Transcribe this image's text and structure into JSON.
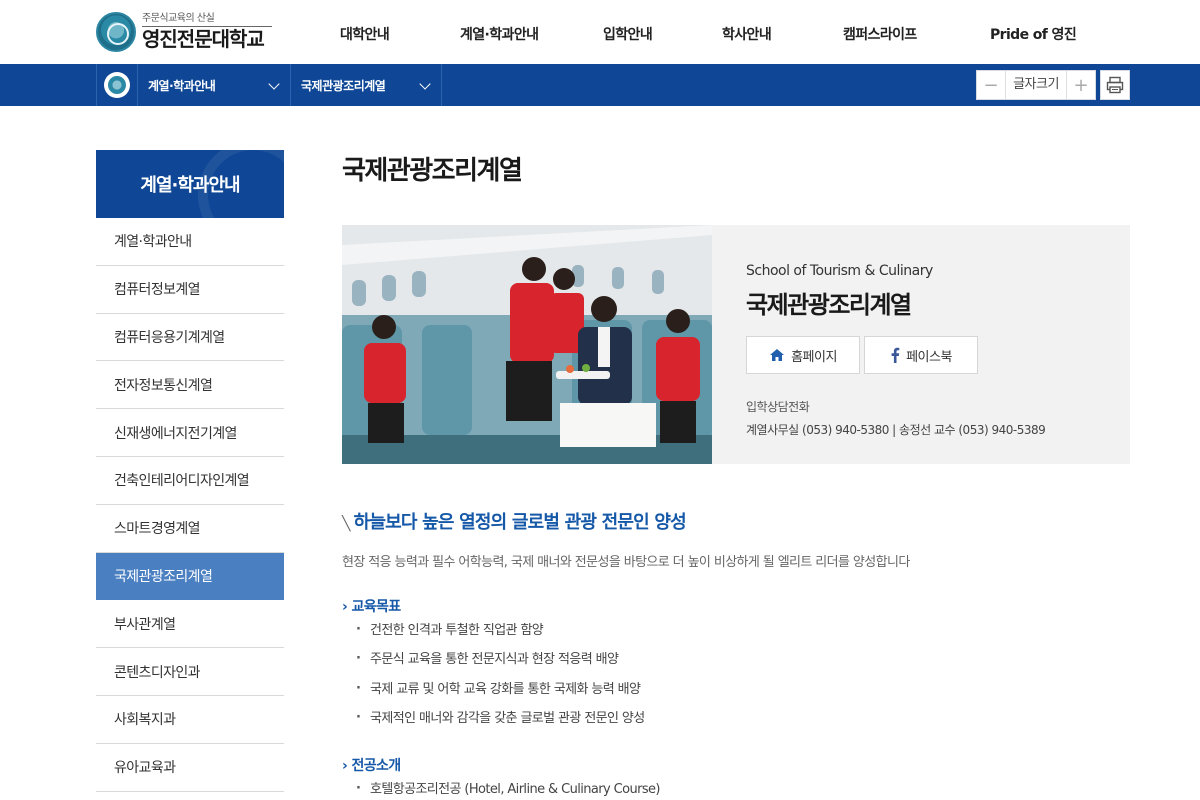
{
  "header": {
    "logo_sub": "주문식교육의 산실",
    "logo_main": "영진전문대학교",
    "menu": [
      "대학안내",
      "계열·학과안내",
      "입학안내",
      "학사안내",
      "캠퍼스라이프",
      "Pride of 영진"
    ]
  },
  "subnav": {
    "depth1": "계열·학과안내",
    "depth2": "국제관광조리계열",
    "font_size_label": "글자크기",
    "font_minus": "−",
    "font_plus": "+"
  },
  "sidebar": {
    "title": "계열·학과안내",
    "items": [
      {
        "label": "계열·학과안내",
        "active": false
      },
      {
        "label": "컴퓨터정보계열",
        "active": false
      },
      {
        "label": "컴퓨터응용기계계열",
        "active": false
      },
      {
        "label": "전자정보통신계열",
        "active": false
      },
      {
        "label": "신재생에너지전기계열",
        "active": false
      },
      {
        "label": "건축인테리어디자인계열",
        "active": false
      },
      {
        "label": "스마트경영계열",
        "active": false
      },
      {
        "label": "국제관광조리계열",
        "active": true
      },
      {
        "label": "부사관계열",
        "active": false
      },
      {
        "label": "콘텐츠디자인과",
        "active": false
      },
      {
        "label": "사회복지과",
        "active": false
      },
      {
        "label": "유아교육과",
        "active": false
      }
    ]
  },
  "main": {
    "page_title": "국제관광조리계열",
    "hero": {
      "english_name": "School of Tourism & Culinary",
      "korean_name": "국제관광조리계열",
      "homepage_label": "홈페이지",
      "facebook_label": "페이스북",
      "contact_label": "입학상담전화",
      "contact_text": "계열사무실 (053) 940-5380  |  송정선 교수 (053) 940-5389"
    },
    "slogan": "하늘보다 높은 열정의 글로벌 관광 전문인 양성",
    "description": "현장 적응 능력과 필수 어학능력, 국제 매너와 전문성을 바탕으로 더 높이 비상하게 될 엘리트 리더를 양성합니다",
    "goals_title": "교육목표",
    "goals": [
      "건전한 인격과 투철한 직업관 함양",
      "주문식 교육을 통한 전문지식과 현장 적응력 배양",
      "국제 교류 및 어학 교육 강화를 통한 국제화 능력 배양",
      "국제적인 매너와 감각을 갖춘 글로벌 관광 전문인 양성"
    ],
    "majors_title": "전공소개",
    "majors": [
      "호텔항공조리전공 (Hotel, Airline & Culinary Course)"
    ]
  },
  "colors": {
    "primary_blue": "#0f4796",
    "active_menu": "#4a7fc1",
    "heading_blue": "#1658a8",
    "facebook_blue": "#3b5998",
    "home_icon_blue": "#1f5fae"
  }
}
